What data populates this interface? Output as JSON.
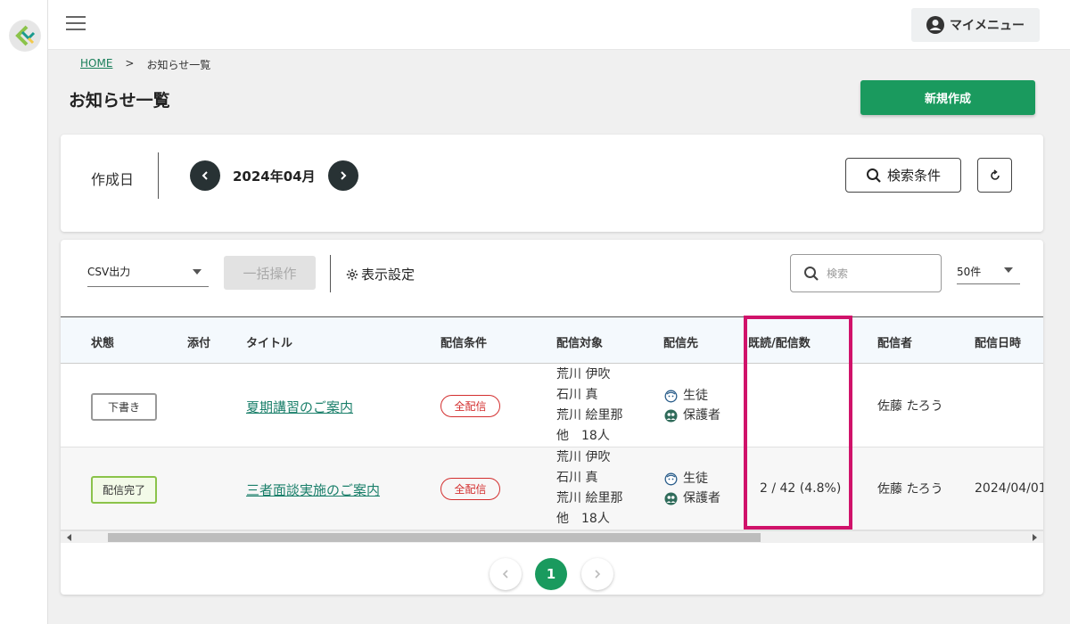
{
  "header": {
    "my_menu_label": "マイメニュー"
  },
  "breadcrumb": {
    "home": "HOME",
    "separator": ">",
    "current": "お知らせ一覧"
  },
  "page": {
    "title": "お知らせ一覧",
    "new_button": "新規作成"
  },
  "filter": {
    "date_label": "作成日",
    "month": "2024年04月",
    "search_conditions": "検索条件"
  },
  "toolbar": {
    "csv_label": "CSV出力",
    "bulk_label": "一括操作",
    "display_settings": "表示設定",
    "search_placeholder": "検索",
    "per_page": "50件"
  },
  "table": {
    "headers": [
      "状態",
      "添付",
      "タイトル",
      "配信条件",
      "配信対象",
      "配信先",
      "既読/配信数",
      "配信者",
      "配信日時"
    ],
    "rows": [
      {
        "status": "下書き",
        "title": "夏期講習のご案内",
        "condition": "全配信",
        "targets": [
          "荒川 伊吹",
          "石川 真",
          "荒川 絵里那",
          "他　18人"
        ],
        "dest": [
          "生徒",
          "保護者"
        ],
        "read": "",
        "sender": "佐藤 たろう",
        "date": ""
      },
      {
        "status": "配信完了",
        "title": "三者面談実施のご案内",
        "condition": "全配信",
        "targets": [
          "荒川 伊吹",
          "石川 真",
          "荒川 絵里那",
          "他　18人"
        ],
        "dest": [
          "生徒",
          "保護者"
        ],
        "read": "2 / 42 (4.8%)",
        "sender": "佐藤 たろう",
        "date": "2024/04/01"
      }
    ]
  },
  "pagination": {
    "current": "1"
  },
  "colors": {
    "primary": "#1a9a5e",
    "highlight": "#d0126a",
    "badge_red": "#d32f2f",
    "done_green": "#8bc34a"
  }
}
